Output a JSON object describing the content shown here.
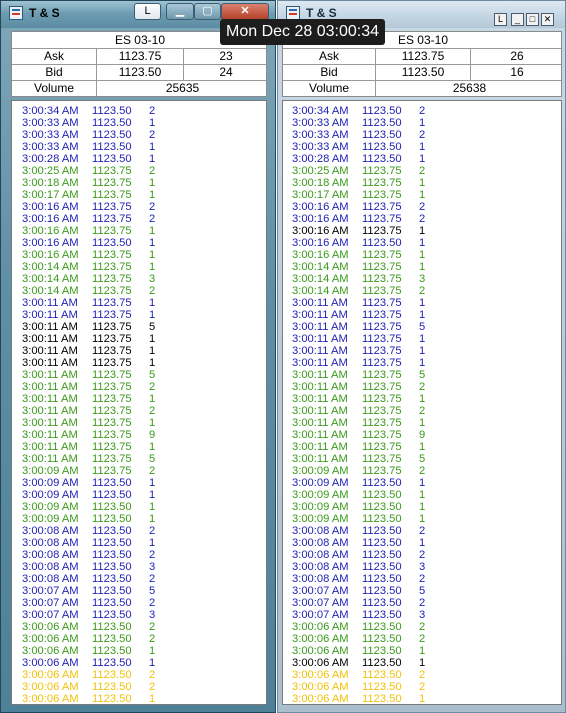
{
  "left_window": {
    "title": "T & S",
    "buttons": {
      "l": "L",
      "min": "▁",
      "max": "▢",
      "close": "✕"
    },
    "summary": {
      "symbol": "ES 03-10",
      "ask_label": "Ask",
      "ask_price": "1123.75",
      "ask_size": "23",
      "bid_label": "Bid",
      "bid_price": "1123.50",
      "bid_size": "24",
      "volume_label": "Volume",
      "volume": "25635"
    }
  },
  "right_window": {
    "title": "T & S",
    "buttons": {
      "l": "L",
      "min": "_",
      "max": "□",
      "close": "✕"
    },
    "summary": {
      "symbol": "ES 03-10",
      "ask_label": "Ask",
      "ask_price": "1123.75",
      "ask_size": "26",
      "bid_label": "Bid",
      "bid_price": "1123.50",
      "bid_size": "16",
      "volume_label": "Volume",
      "volume": "25638"
    }
  },
  "tooltip": "Mon Dec 28 03:00:34",
  "colors": {
    "bid": "#1e1eb4",
    "ask": "#3a9a1a",
    "neutral": "#000000",
    "highlight": "#f2c10a"
  },
  "trades_left": [
    {
      "time": "3:00:34 AM",
      "price": "1123.50",
      "size": "2",
      "side": "bid"
    },
    {
      "time": "3:00:33 AM",
      "price": "1123.50",
      "size": "1",
      "side": "bid"
    },
    {
      "time": "3:00:33 AM",
      "price": "1123.50",
      "size": "2",
      "side": "bid"
    },
    {
      "time": "3:00:33 AM",
      "price": "1123.50",
      "size": "1",
      "side": "bid"
    },
    {
      "time": "3:00:28 AM",
      "price": "1123.50",
      "size": "1",
      "side": "bid"
    },
    {
      "time": "3:00:25 AM",
      "price": "1123.75",
      "size": "2",
      "side": "ask"
    },
    {
      "time": "3:00:18 AM",
      "price": "1123.75",
      "size": "1",
      "side": "ask"
    },
    {
      "time": "3:00:17 AM",
      "price": "1123.75",
      "size": "1",
      "side": "ask"
    },
    {
      "time": "3:00:16 AM",
      "price": "1123.75",
      "size": "2",
      "side": "bid"
    },
    {
      "time": "3:00:16 AM",
      "price": "1123.75",
      "size": "2",
      "side": "bid"
    },
    {
      "time": "3:00:16 AM",
      "price": "1123.75",
      "size": "1",
      "side": "ask"
    },
    {
      "time": "3:00:16 AM",
      "price": "1123.50",
      "size": "1",
      "side": "bid"
    },
    {
      "time": "3:00:16 AM",
      "price": "1123.75",
      "size": "1",
      "side": "ask"
    },
    {
      "time": "3:00:14 AM",
      "price": "1123.75",
      "size": "1",
      "side": "ask"
    },
    {
      "time": "3:00:14 AM",
      "price": "1123.75",
      "size": "3",
      "side": "ask"
    },
    {
      "time": "3:00:14 AM",
      "price": "1123.75",
      "size": "2",
      "side": "ask"
    },
    {
      "time": "3:00:11 AM",
      "price": "1123.75",
      "size": "1",
      "side": "bid"
    },
    {
      "time": "3:00:11 AM",
      "price": "1123.75",
      "size": "1",
      "side": "bid"
    },
    {
      "time": "3:00:11 AM",
      "price": "1123.75",
      "size": "5",
      "side": "neutral"
    },
    {
      "time": "3:00:11 AM",
      "price": "1123.75",
      "size": "1",
      "side": "neutral"
    },
    {
      "time": "3:00:11 AM",
      "price": "1123.75",
      "size": "1",
      "side": "neutral"
    },
    {
      "time": "3:00:11 AM",
      "price": "1123.75",
      "size": "1",
      "side": "neutral"
    },
    {
      "time": "3:00:11 AM",
      "price": "1123.75",
      "size": "5",
      "side": "ask"
    },
    {
      "time": "3:00:11 AM",
      "price": "1123.75",
      "size": "2",
      "side": "ask"
    },
    {
      "time": "3:00:11 AM",
      "price": "1123.75",
      "size": "1",
      "side": "ask"
    },
    {
      "time": "3:00:11 AM",
      "price": "1123.75",
      "size": "2",
      "side": "ask"
    },
    {
      "time": "3:00:11 AM",
      "price": "1123.75",
      "size": "1",
      "side": "ask"
    },
    {
      "time": "3:00:11 AM",
      "price": "1123.75",
      "size": "9",
      "side": "ask"
    },
    {
      "time": "3:00:11 AM",
      "price": "1123.75",
      "size": "1",
      "side": "ask"
    },
    {
      "time": "3:00:11 AM",
      "price": "1123.75",
      "size": "5",
      "side": "ask"
    },
    {
      "time": "3:00:09 AM",
      "price": "1123.75",
      "size": "2",
      "side": "ask"
    },
    {
      "time": "3:00:09 AM",
      "price": "1123.50",
      "size": "1",
      "side": "bid"
    },
    {
      "time": "3:00:09 AM",
      "price": "1123.50",
      "size": "1",
      "side": "bid"
    },
    {
      "time": "3:00:09 AM",
      "price": "1123.50",
      "size": "1",
      "side": "ask"
    },
    {
      "time": "3:00:09 AM",
      "price": "1123.50",
      "size": "1",
      "side": "ask"
    },
    {
      "time": "3:00:08 AM",
      "price": "1123.50",
      "size": "2",
      "side": "bid"
    },
    {
      "time": "3:00:08 AM",
      "price": "1123.50",
      "size": "1",
      "side": "bid"
    },
    {
      "time": "3:00:08 AM",
      "price": "1123.50",
      "size": "2",
      "side": "bid"
    },
    {
      "time": "3:00:08 AM",
      "price": "1123.50",
      "size": "3",
      "side": "bid"
    },
    {
      "time": "3:00:08 AM",
      "price": "1123.50",
      "size": "2",
      "side": "bid"
    },
    {
      "time": "3:00:07 AM",
      "price": "1123.50",
      "size": "5",
      "side": "bid"
    },
    {
      "time": "3:00:07 AM",
      "price": "1123.50",
      "size": "2",
      "side": "bid"
    },
    {
      "time": "3:00:07 AM",
      "price": "1123.50",
      "size": "3",
      "side": "bid"
    },
    {
      "time": "3:00:06 AM",
      "price": "1123.50",
      "size": "2",
      "side": "ask"
    },
    {
      "time": "3:00:06 AM",
      "price": "1123.50",
      "size": "2",
      "side": "ask"
    },
    {
      "time": "3:00:06 AM",
      "price": "1123.50",
      "size": "1",
      "side": "ask"
    },
    {
      "time": "3:00:06 AM",
      "price": "1123.50",
      "size": "1",
      "side": "bid"
    },
    {
      "time": "3:00:06 AM",
      "price": "1123.50",
      "size": "2",
      "side": "highlight"
    },
    {
      "time": "3:00:06 AM",
      "price": "1123.50",
      "size": "2",
      "side": "highlight"
    },
    {
      "time": "3:00:06 AM",
      "price": "1123.50",
      "size": "1",
      "side": "highlight"
    }
  ],
  "trades_right": [
    {
      "time": "3:00:34 AM",
      "price": "1123.50",
      "size": "2",
      "side": "bid"
    },
    {
      "time": "3:00:33 AM",
      "price": "1123.50",
      "size": "1",
      "side": "bid"
    },
    {
      "time": "3:00:33 AM",
      "price": "1123.50",
      "size": "2",
      "side": "bid"
    },
    {
      "time": "3:00:33 AM",
      "price": "1123.50",
      "size": "1",
      "side": "bid"
    },
    {
      "time": "3:00:28 AM",
      "price": "1123.50",
      "size": "1",
      "side": "bid"
    },
    {
      "time": "3:00:25 AM",
      "price": "1123.75",
      "size": "2",
      "side": "ask"
    },
    {
      "time": "3:00:18 AM",
      "price": "1123.75",
      "size": "1",
      "side": "ask"
    },
    {
      "time": "3:00:17 AM",
      "price": "1123.75",
      "size": "1",
      "side": "ask"
    },
    {
      "time": "3:00:16 AM",
      "price": "1123.75",
      "size": "2",
      "side": "bid"
    },
    {
      "time": "3:00:16 AM",
      "price": "1123.75",
      "size": "2",
      "side": "bid"
    },
    {
      "time": "3:00:16 AM",
      "price": "1123.75",
      "size": "1",
      "side": "neutral"
    },
    {
      "time": "3:00:16 AM",
      "price": "1123.50",
      "size": "1",
      "side": "bid"
    },
    {
      "time": "3:00:16 AM",
      "price": "1123.75",
      "size": "1",
      "side": "ask"
    },
    {
      "time": "3:00:14 AM",
      "price": "1123.75",
      "size": "1",
      "side": "ask"
    },
    {
      "time": "3:00:14 AM",
      "price": "1123.75",
      "size": "3",
      "side": "ask"
    },
    {
      "time": "3:00:14 AM",
      "price": "1123.75",
      "size": "2",
      "side": "ask"
    },
    {
      "time": "3:00:11 AM",
      "price": "1123.75",
      "size": "1",
      "side": "bid"
    },
    {
      "time": "3:00:11 AM",
      "price": "1123.75",
      "size": "1",
      "side": "bid"
    },
    {
      "time": "3:00:11 AM",
      "price": "1123.75",
      "size": "5",
      "side": "bid"
    },
    {
      "time": "3:00:11 AM",
      "price": "1123.75",
      "size": "1",
      "side": "bid"
    },
    {
      "time": "3:00:11 AM",
      "price": "1123.75",
      "size": "1",
      "side": "bid"
    },
    {
      "time": "3:00:11 AM",
      "price": "1123.75",
      "size": "1",
      "side": "bid"
    },
    {
      "time": "3:00:11 AM",
      "price": "1123.75",
      "size": "5",
      "side": "ask"
    },
    {
      "time": "3:00:11 AM",
      "price": "1123.75",
      "size": "2",
      "side": "ask"
    },
    {
      "time": "3:00:11 AM",
      "price": "1123.75",
      "size": "1",
      "side": "ask"
    },
    {
      "time": "3:00:11 AM",
      "price": "1123.75",
      "size": "2",
      "side": "ask"
    },
    {
      "time": "3:00:11 AM",
      "price": "1123.75",
      "size": "1",
      "side": "ask"
    },
    {
      "time": "3:00:11 AM",
      "price": "1123.75",
      "size": "9",
      "side": "ask"
    },
    {
      "time": "3:00:11 AM",
      "price": "1123.75",
      "size": "1",
      "side": "ask"
    },
    {
      "time": "3:00:11 AM",
      "price": "1123.75",
      "size": "5",
      "side": "ask"
    },
    {
      "time": "3:00:09 AM",
      "price": "1123.75",
      "size": "2",
      "side": "ask"
    },
    {
      "time": "3:00:09 AM",
      "price": "1123.50",
      "size": "1",
      "side": "bid"
    },
    {
      "time": "3:00:09 AM",
      "price": "1123.50",
      "size": "1",
      "side": "ask"
    },
    {
      "time": "3:00:09 AM",
      "price": "1123.50",
      "size": "1",
      "side": "ask"
    },
    {
      "time": "3:00:09 AM",
      "price": "1123.50",
      "size": "1",
      "side": "ask"
    },
    {
      "time": "3:00:08 AM",
      "price": "1123.50",
      "size": "2",
      "side": "bid"
    },
    {
      "time": "3:00:08 AM",
      "price": "1123.50",
      "size": "1",
      "side": "bid"
    },
    {
      "time": "3:00:08 AM",
      "price": "1123.50",
      "size": "2",
      "side": "bid"
    },
    {
      "time": "3:00:08 AM",
      "price": "1123.50",
      "size": "3",
      "side": "bid"
    },
    {
      "time": "3:00:08 AM",
      "price": "1123.50",
      "size": "2",
      "side": "bid"
    },
    {
      "time": "3:00:07 AM",
      "price": "1123.50",
      "size": "5",
      "side": "bid"
    },
    {
      "time": "3:00:07 AM",
      "price": "1123.50",
      "size": "2",
      "side": "bid"
    },
    {
      "time": "3:00:07 AM",
      "price": "1123.50",
      "size": "3",
      "side": "bid"
    },
    {
      "time": "3:00:06 AM",
      "price": "1123.50",
      "size": "2",
      "side": "ask"
    },
    {
      "time": "3:00:06 AM",
      "price": "1123.50",
      "size": "2",
      "side": "ask"
    },
    {
      "time": "3:00:06 AM",
      "price": "1123.50",
      "size": "1",
      "side": "ask"
    },
    {
      "time": "3:00:06 AM",
      "price": "1123.50",
      "size": "1",
      "side": "neutral"
    },
    {
      "time": "3:00:06 AM",
      "price": "1123.50",
      "size": "2",
      "side": "highlight"
    },
    {
      "time": "3:00:06 AM",
      "price": "1123.50",
      "size": "2",
      "side": "highlight"
    },
    {
      "time": "3:00:06 AM",
      "price": "1123.50",
      "size": "1",
      "side": "highlight"
    }
  ]
}
